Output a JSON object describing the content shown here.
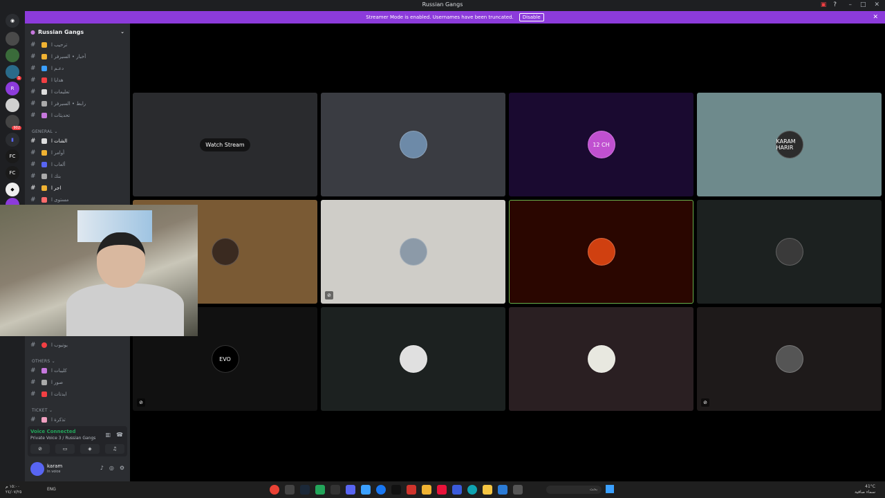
{
  "window": {
    "title": "Russian Gangs"
  },
  "banner": {
    "text": "Streamer Mode is enabled. Usernames have been truncated.",
    "disable_label": "Disable"
  },
  "server": {
    "name": "Russian Gangs"
  },
  "channels": [
    {
      "label": "ترحيب ا",
      "color": "#f0b232",
      "active": false
    },
    {
      "label": "أخبار • السيرفر ا",
      "color": "#f0b232",
      "active": false
    },
    {
      "label": "دعـم ا",
      "color": "#3ba0ff",
      "active": false
    },
    {
      "label": "هدايا ا",
      "color": "#f23f43",
      "active": false
    },
    {
      "label": "تعليمات ا",
      "color": "#dddddd",
      "active": false
    },
    {
      "label": "رابط • السيرفر ا",
      "color": "#aaaaaa",
      "active": false
    },
    {
      "label": "تحديثات ا",
      "color": "#c678dd",
      "active": false
    }
  ],
  "categories": {
    "general": "GENERAL",
    "others": "OTHERS",
    "ticket": "TICKET"
  },
  "general_channels": [
    {
      "label": "الشات ا",
      "color": "#dddddd",
      "active": true
    },
    {
      "label": "أوامر ا",
      "color": "#f0b232",
      "active": false
    },
    {
      "label": "ألعاب ا",
      "color": "#5865f2",
      "active": false
    },
    {
      "label": "بنك ا",
      "color": "#aaaaaa",
      "active": false
    },
    {
      "label": "اجر ا",
      "color": "#f0b232",
      "active": true
    },
    {
      "label": "مستوى ا",
      "color": "#ff6b6b",
      "active": false
    }
  ],
  "youtube_channel": {
    "label": "يوتيوب ا",
    "color": "#f23f43"
  },
  "other_channels": [
    {
      "label": "كليبات ا",
      "color": "#c678dd"
    },
    {
      "label": "صور ا",
      "color": "#aaaaaa"
    },
    {
      "label": "ايدتات ا",
      "color": "#f23f43"
    }
  ],
  "ticket_channels": [
    {
      "label": "تذكرة ا",
      "color": "#f0a0c0"
    }
  ],
  "voice": {
    "status": "Voice Connected",
    "channel": "Private Voice 3 / Russian Gangs"
  },
  "user": {
    "name": "karam",
    "status": "In voice"
  },
  "tiles": [
    {
      "kind": "stream",
      "bg": "#2a2b2e",
      "watch_label": "Watch Stream"
    },
    {
      "kind": "avatar",
      "bg": "#3a3c42",
      "avcolor": "#6d8aa8",
      "muted": false
    },
    {
      "kind": "avatar",
      "bg": "#1a0a30",
      "avcolor": "#c050d0",
      "muted": false,
      "avlabel": "12 CH"
    },
    {
      "kind": "avatar",
      "bg": "#6e8a8c",
      "avcolor": "#2c2c2c",
      "muted": false,
      "avlabel": "KARAM HARIR"
    },
    {
      "kind": "avatar",
      "bg": "#7a5a34",
      "avcolor": "#3a2a20",
      "muted": false
    },
    {
      "kind": "avatar",
      "bg": "#cfcdc8",
      "avcolor": "#8c9aa8",
      "muted": true
    },
    {
      "kind": "avatar",
      "bg": "#2a0600",
      "avcolor": "#d04010",
      "muted": false,
      "speaking": true
    },
    {
      "kind": "avatar",
      "bg": "#1c2120",
      "avcolor": "#3a3a3a",
      "muted": false
    },
    {
      "kind": "avatar",
      "bg": "#111111",
      "avcolor": "#000000",
      "muted": true,
      "avlabel": "EVO"
    },
    {
      "kind": "avatar",
      "bg": "#1c2120",
      "avcolor": "#e0e0e0",
      "muted": false
    },
    {
      "kind": "avatar",
      "bg": "#2a1f22",
      "avcolor": "#e8e8e0",
      "muted": false
    },
    {
      "kind": "avatar",
      "bg": "#1e1a1a",
      "avcolor": "#555555",
      "muted": true
    }
  ],
  "taskbar": {
    "time": "١٥:٠٠ م",
    "date": "٢٤/٠٧/٢٥",
    "lang": "ENG",
    "search_placeholder": "بحث",
    "weather_temp": "41°C",
    "weather_desc": "سماء صافية"
  },
  "colors": {
    "accent": "#8c3bdb",
    "voice_green": "#23a55a",
    "speaking_border": "#6ab04c"
  }
}
